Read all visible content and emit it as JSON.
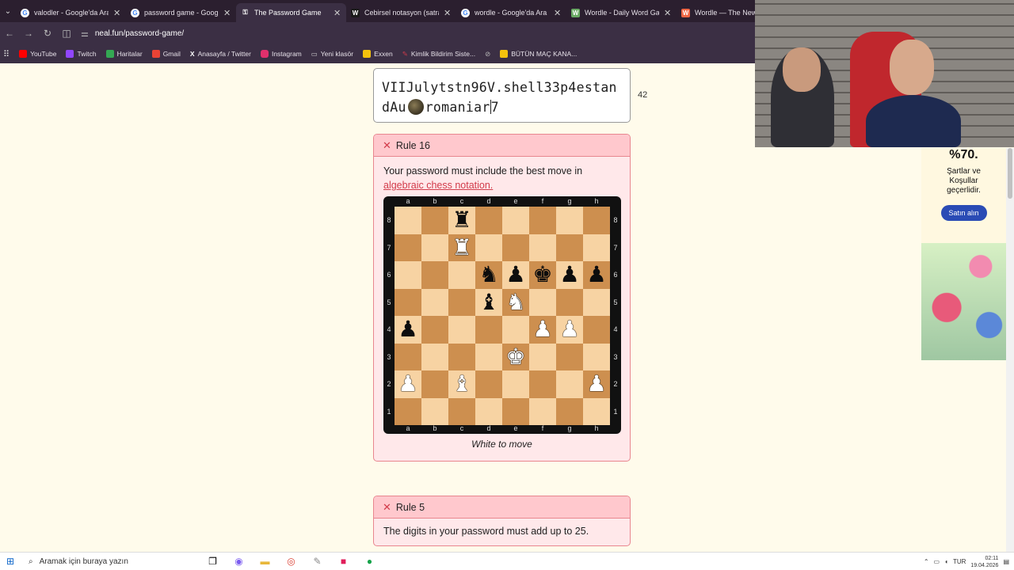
{
  "browser": {
    "tabs": [
      {
        "label": "valodler - Google'da Ara",
        "icon": "google-icon",
        "active": false
      },
      {
        "label": "password game - Google",
        "icon": "google-icon",
        "active": false
      },
      {
        "label": "The Password Game",
        "icon": "password-game-icon",
        "active": true
      },
      {
        "label": "Cebirsel notasyon (satranç",
        "icon": "wikipedia-icon",
        "active": false
      },
      {
        "label": "wordle - Google'da Ara",
        "icon": "google-icon",
        "active": false
      },
      {
        "label": "Wordle - Daily Word Game",
        "icon": "wordle-icon",
        "active": false
      },
      {
        "label": "Wordle — The New Y",
        "icon": "nyt-icon",
        "active": false
      }
    ],
    "url": "neal.fun/password-game/",
    "bookmarks": [
      {
        "label": "YouTube",
        "color": "#ff0000"
      },
      {
        "label": "Twitch",
        "color": "#9146ff"
      },
      {
        "label": "Haritalar",
        "color": "#34a853"
      },
      {
        "label": "Gmail",
        "color": "#ea4335"
      },
      {
        "label": "Anasayfa / Twitter",
        "color": "#000000"
      },
      {
        "label": "Instagram",
        "color": "#e1306c"
      },
      {
        "label": "Yeni klasör",
        "color": "#cccccc"
      },
      {
        "label": "Exxen",
        "color": "#f4c20d"
      },
      {
        "label": "Kimlik Bildirim Siste...",
        "color": "#d23b4a"
      },
      {
        "label": "",
        "color": "#aaaaaa"
      },
      {
        "label": "BÜTÜN MAÇ KANA...",
        "color": "#f4c20d"
      }
    ]
  },
  "password": {
    "part1": "VIIJulytstn96V.shell33p4estan",
    "part2": "dAu",
    "moon_icon": "moon-emoji-icon",
    "part3": "romania",
    "part4": "r",
    "part5": "7",
    "char_count": "42"
  },
  "rules": [
    {
      "title": "Rule 16",
      "text_before": "Your password must include the best move in ",
      "link_text": "algebraic chess notation.",
      "caption": "White to move",
      "board": {
        "files": [
          "a",
          "b",
          "c",
          "d",
          "e",
          "f",
          "g",
          "h"
        ],
        "ranks": [
          "8",
          "7",
          "6",
          "5",
          "4",
          "3",
          "2",
          "1"
        ],
        "position": [
          [
            "",
            "",
            "bR",
            "",
            "",
            "",
            "",
            ""
          ],
          [
            "",
            "",
            "wR",
            "",
            "",
            "",
            "",
            ""
          ],
          [
            "",
            "",
            "",
            "bN",
            "bP",
            "bK",
            "bP",
            "bP"
          ],
          [
            "",
            "",
            "",
            "bB",
            "wN",
            "",
            "",
            ""
          ],
          [
            "bP",
            "",
            "",
            "",
            "",
            "wP",
            "wP",
            ""
          ],
          [
            "",
            "",
            "",
            "",
            "wK",
            "",
            "",
            ""
          ],
          [
            "wP",
            "",
            "wB",
            "",
            "",
            "",
            "",
            "wP"
          ],
          [
            "",
            "",
            "",
            "",
            "",
            "",
            "",
            ""
          ]
        ]
      }
    },
    {
      "title": "Rule 5",
      "text": "The digits in your password must add up to 25."
    }
  ],
  "ad": {
    "percent": "%70.",
    "line1": "Şartlar ve",
    "line2": "Koşullar",
    "line3": "geçerlidir.",
    "button": "Satın alın"
  },
  "taskbar": {
    "search_placeholder": "Aramak için buraya yazın",
    "lang": "TUR",
    "time": "02:11",
    "date": "19.04.2026"
  },
  "colors": {
    "rule_fail_bg": "#ffe8ea",
    "rule_fail_header": "#ffc8cd",
    "rule_fail_accent": "#d23b4a",
    "board_light": "#f7d3a3",
    "board_dark": "#cd8f4f",
    "page_bg": "#fffbeb"
  }
}
